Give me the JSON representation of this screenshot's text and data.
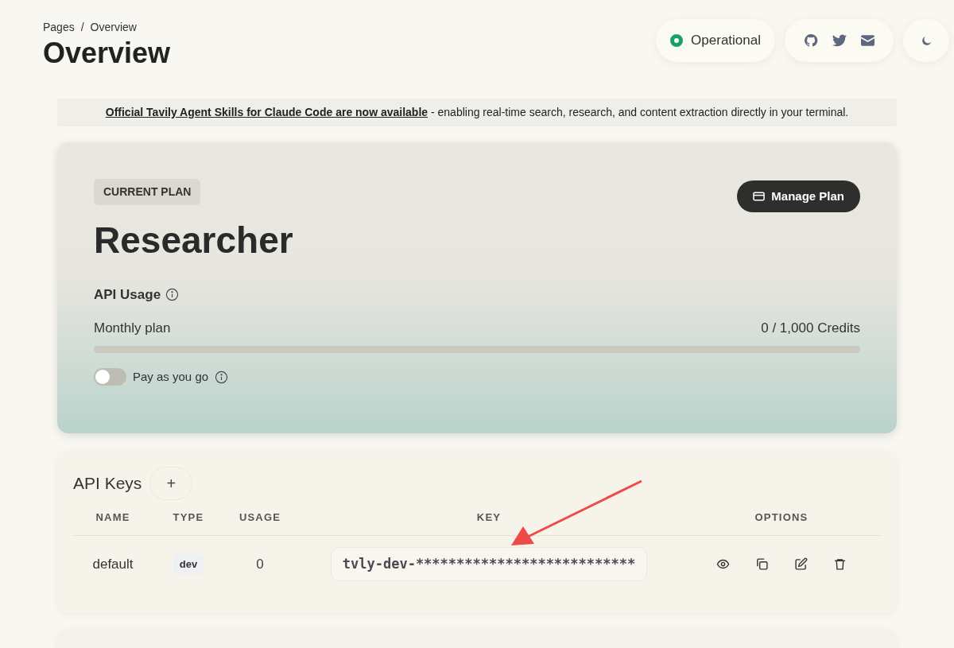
{
  "breadcrumb": [
    "Pages",
    "Overview"
  ],
  "breadcrumb_separator": "/",
  "page_title": "Overview",
  "status": {
    "label": "Operational"
  },
  "banner": {
    "link": "Official Tavily Agent Skills for Claude Code are now available",
    "text": " - enabling real-time search, research, and content extraction directly in your terminal."
  },
  "plan": {
    "badge": "CURRENT PLAN",
    "name": "Researcher",
    "button": "Manage Plan",
    "usage": {
      "title": "API Usage",
      "plan_label": "Monthly plan",
      "credits": "0 / 1,000 Credits",
      "level": 0
    },
    "pay_as_you_go": {
      "label": "Pay as you go",
      "on": false
    }
  },
  "api_keys": {
    "title": "API Keys",
    "add_button": "+",
    "columns": [
      "NAME",
      "TYPE",
      "USAGE",
      "KEY",
      "OPTIONS"
    ],
    "rows": [
      {
        "name": "default",
        "type": "dev",
        "usage": "0",
        "key": "tvly-dev-***************************"
      }
    ]
  }
}
